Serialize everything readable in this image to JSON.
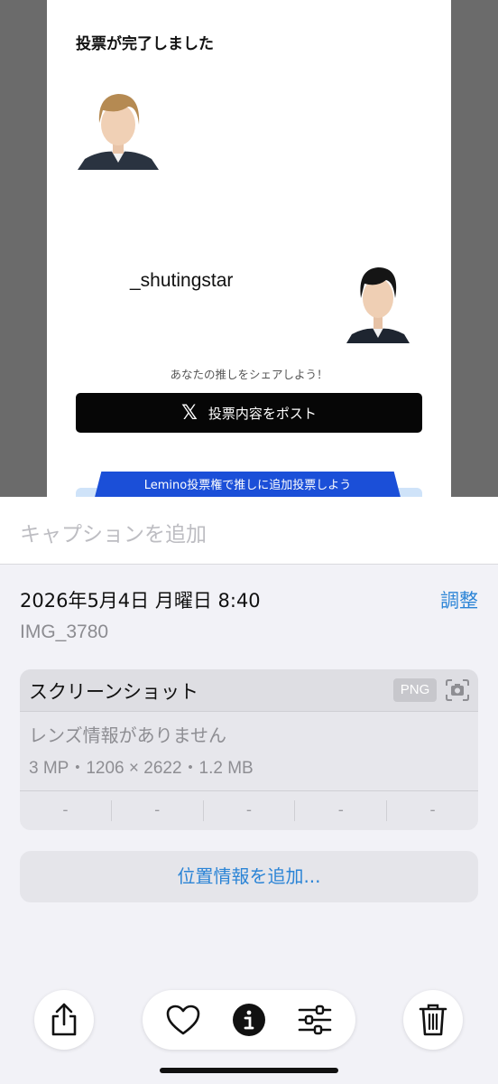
{
  "preview": {
    "title": "投票が完了しました",
    "username": "_shutingstar",
    "share_hint": "あなたの推しをシェアしよう！",
    "post_button": "投票内容をポスト",
    "x_logo": "𝕏",
    "lemino_banner": "Lemino投票権で推しに追加投票しよう"
  },
  "info": {
    "caption_placeholder": "キャプションを追加",
    "datetime": "2026年5月4日 月曜日 8:40",
    "adjust_label": "調整",
    "filename": "IMG_3780",
    "meta": {
      "type": "スクリーンショット",
      "format_badge": "PNG",
      "lens_info": "レンズ情報がありません",
      "spec": "3 MP・1206 × 2622・1.2 MB",
      "exif": [
        "-",
        "-",
        "-",
        "-",
        "-"
      ]
    },
    "location_button": "位置情報を追加..."
  },
  "toolbar": {
    "icons": [
      "share-icon",
      "heart-icon",
      "info-icon",
      "adjust-icon",
      "trash-icon"
    ]
  },
  "colors": {
    "accent": "#2b84d6",
    "lemino": "#1b4fd8"
  }
}
